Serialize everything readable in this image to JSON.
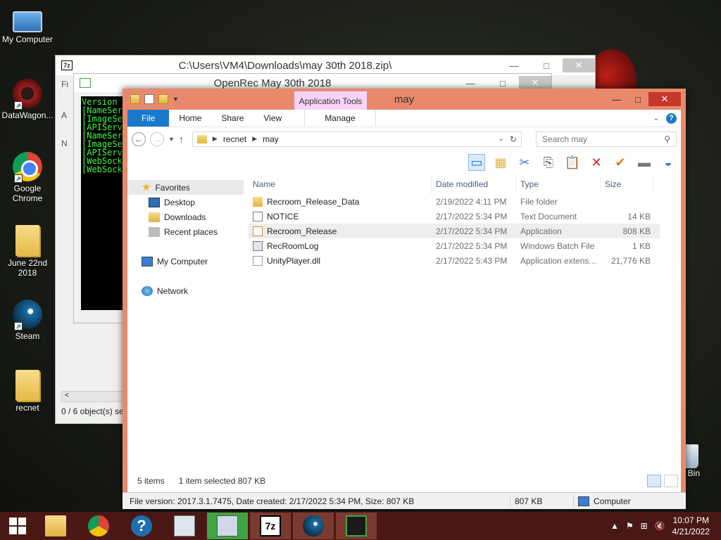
{
  "desktop": {
    "icons": [
      {
        "label": "My Computer",
        "icon": "computer-icon"
      },
      {
        "label": "DataWagon...",
        "icon": "gear-icon"
      },
      {
        "label": "Google Chrome",
        "icon": "chrome-icon"
      },
      {
        "label": "June 22nd 2018",
        "icon": "folder-icon"
      },
      {
        "label": "Steam",
        "icon": "steam-icon"
      },
      {
        "label": "recnet",
        "icon": "folder-icon"
      }
    ],
    "recycle_bin_label": "cle Bin"
  },
  "sevenzip_window": {
    "title": "C:\\Users\\VM4\\Downloads\\may 30th 2018.zip\\",
    "logo": "7z",
    "status": "0 / 6 object(s) se",
    "menu_fragment": "Fi",
    "left_letters": [
      "A",
      "N"
    ]
  },
  "openrec_window": {
    "title": "OpenRec May 30th 2018",
    "console_lines": [
      "Version",
      "[NameSer",
      "[ImageSe",
      "[APIServ",
      "[NameSer",
      "[ImageSe",
      "[APIServ",
      "[WebSock",
      "[WebSock"
    ]
  },
  "explorer": {
    "title": "may",
    "context_tab": "Application Tools",
    "tabs": [
      "File",
      "Home",
      "Share",
      "View",
      "Manage"
    ],
    "address": {
      "path": [
        "recnet",
        "may"
      ]
    },
    "search_placeholder": "Search may",
    "nav": {
      "favorites": "Favorites",
      "desktop": "Desktop",
      "downloads": "Downloads",
      "recent": "Recent places",
      "computer": "My Computer",
      "network": "Network"
    },
    "columns": {
      "name": "Name",
      "date": "Date modified",
      "type": "Type",
      "size": "Size"
    },
    "files": [
      {
        "name": "Recroom_Release_Data",
        "date": "2/19/2022 4:11 PM",
        "type": "File folder",
        "size": "",
        "icon": "folder"
      },
      {
        "name": "NOTICE",
        "date": "2/17/2022 5:34 PM",
        "type": "Text Document",
        "size": "14 KB",
        "icon": "txt"
      },
      {
        "name": "Recroom_Release",
        "date": "2/17/2022 5:34 PM",
        "type": "Application",
        "size": "808 KB",
        "icon": "app"
      },
      {
        "name": "RecRoomLog",
        "date": "2/17/2022 5:34 PM",
        "type": "Windows Batch File",
        "size": "1 KB",
        "icon": "bat"
      },
      {
        "name": "UnityPlayer.dll",
        "date": "2/17/2022 5:43 PM",
        "type": "Application extens...",
        "size": "21,776 KB",
        "icon": "dll"
      }
    ],
    "items_count": "5 items",
    "selection": "1 item selected  807 KB",
    "status_details": "File version: 2017.3.1.7475, Date created: 2/17/2022 5:34 PM, Size: 807 KB",
    "status_size": "807 KB",
    "status_location": "Computer"
  },
  "taskbar": {
    "apps": [
      "file-explorer",
      "chrome",
      "help",
      "performance-monitor",
      "remote-desktop",
      "7-zip",
      "steam",
      "openrec"
    ],
    "time": "10:07 PM",
    "date": "4/21/2022"
  }
}
